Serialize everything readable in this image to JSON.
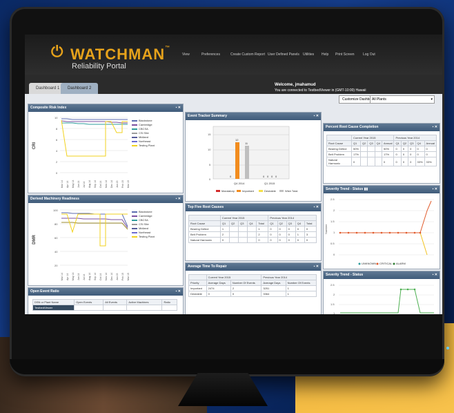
{
  "app": {
    "brand": "WATCHMAN",
    "tm": "™",
    "subtitle": "Reliability Portal",
    "power_icon": "power-icon"
  },
  "nav": [
    "View",
    "Preferences",
    "Create Custom Report",
    "User Defined Panels",
    "Utilities",
    "Help",
    "Print Screen",
    "Log Out"
  ],
  "welcome": {
    "line1": "Welcome, jmahamud",
    "line2": "You are connected to TestbedViewer in (GMT-10:00) Hawaii"
  },
  "tabs": [
    "Dashboard 1",
    "Dashboard 2"
  ],
  "toolbar": {
    "customize": "Customize Dashboard",
    "plant_select": "All Plants"
  },
  "panels": {
    "cri": {
      "title": "Composite Risk Index",
      "ylabel": "CRI",
      "legend": [
        "Blackstone",
        "Cambridge",
        "CBCSA",
        "CSI Site",
        "Midland",
        "Northeast",
        "Testing Plant"
      ],
      "colors": [
        "#5b6bb0",
        "#7a4fa0",
        "#2e9c9c",
        "#9b9b9b",
        "#555a99",
        "#6c6cd0",
        "#f2d21e"
      ],
      "xticks": [
        "Mar 14",
        "Apr 14",
        "May 14",
        "Jun 14",
        "Jul 14",
        "Aug 14",
        "Sep 14",
        "Oct 14",
        "Nov 14",
        "Dec 14",
        "Jan 15",
        "Feb 15",
        "Mar 15"
      ],
      "yticks": [
        "10",
        "8",
        "6",
        "4",
        "2",
        "0"
      ]
    },
    "dmr": {
      "title": "Derived Machinery Readiness",
      "ylabel": "DMR",
      "legend": [
        "Blackstone",
        "Cambridge",
        "CBCSA",
        "CSI Site",
        "Midland",
        "Northeast",
        "Testing Plant"
      ],
      "yticks": [
        "100",
        "80",
        "60",
        "40",
        "20"
      ]
    },
    "oer": {
      "title": "Open Event Ratio",
      "headers": [
        "DSN or Plant Name",
        "Open Events",
        "All Events",
        "Active Machines",
        "Ratio"
      ],
      "row": [
        "TestbedViewer",
        "",
        "",
        "",
        ""
      ]
    },
    "ets": {
      "title": "Event Tracker Summary",
      "yticks": [
        "15",
        "10",
        "5",
        "0"
      ],
      "categories": [
        "Q4 2014",
        "Q1 2015"
      ],
      "bar_labels": [
        "0",
        "12",
        "11",
        "0",
        "0",
        "0",
        "0"
      ],
      "legend": [
        "Mandatory",
        "Important",
        "Desirable",
        "Wish Total"
      ],
      "legend_colors": [
        "#d32b2b",
        "#f28c1e",
        "#f5e04a",
        "#bfbfbf"
      ]
    },
    "tfrc": {
      "title": "Top Five Root Causes",
      "group_current": "Current Year 2015",
      "group_previous": "Previous Year 2014",
      "headers": [
        "Root Cause",
        "Q1",
        "Q2",
        "Q3",
        "Q4",
        "Total",
        "Q1",
        "Q2",
        "Q3",
        "Q4",
        "Total"
      ],
      "rows": [
        [
          "Bearing Defect",
          "1",
          "",
          "",
          "",
          "1",
          "0",
          "0",
          "0",
          "0",
          "0"
        ],
        [
          "Belt Problem",
          "2",
          "",
          "",
          "",
          "2",
          "0",
          "0",
          "0",
          "1",
          "3"
        ],
        [
          "Natural Harmonic",
          "0",
          "",
          "",
          "",
          "0",
          "0",
          "0",
          "0",
          "0",
          "0"
        ]
      ]
    },
    "attr": {
      "title": "Average Time To Repair",
      "group_current": "Current Year 2015",
      "group_previous": "Previous Year 2014",
      "headers": [
        "Priority",
        "Average Days",
        "Number Of Events",
        "Average Days",
        "Number Of Events"
      ],
      "rows": [
        [
          "Important",
          "2474",
          "2",
          "3251",
          "1"
        ],
        [
          "Desirable",
          "0",
          "0",
          "3364",
          "1"
        ]
      ]
    },
    "prc": {
      "title": "Percent Root Cause Completion",
      "group_current": "Current Year 2015",
      "group_previous": "Previous Year 2014",
      "headers": [
        "Root Cause",
        "Q1",
        "Q2",
        "Q3",
        "Q4",
        "Annual",
        "Q1",
        "Q2",
        "Q3",
        "Q4",
        "Annual"
      ],
      "rows": [
        [
          "Bearing Defect",
          "50%",
          "",
          "",
          "",
          "50%",
          "0",
          "0",
          "0",
          "0",
          "0"
        ],
        [
          "Belt Problem",
          "17%",
          "",
          "",
          "",
          "17%",
          "0",
          "0",
          "0",
          "0",
          "0"
        ],
        [
          "Natural Harmonic",
          "0",
          "",
          "",
          "",
          "0",
          "0",
          "0",
          "0",
          "33%",
          "33%"
        ]
      ]
    },
    "st1": {
      "title": "Severity Trend - Status",
      "ylabel": "Number",
      "yticks": [
        "2.5",
        "2",
        "1.5",
        "1",
        "0.5",
        "0"
      ],
      "legend": [
        "UNKNOWN",
        "CRITICAL",
        "ALARM"
      ]
    },
    "st2": {
      "title": "Severity Trend - Status",
      "yticks": [
        "2.5",
        "2",
        "1.5",
        "1"
      ]
    }
  }
}
